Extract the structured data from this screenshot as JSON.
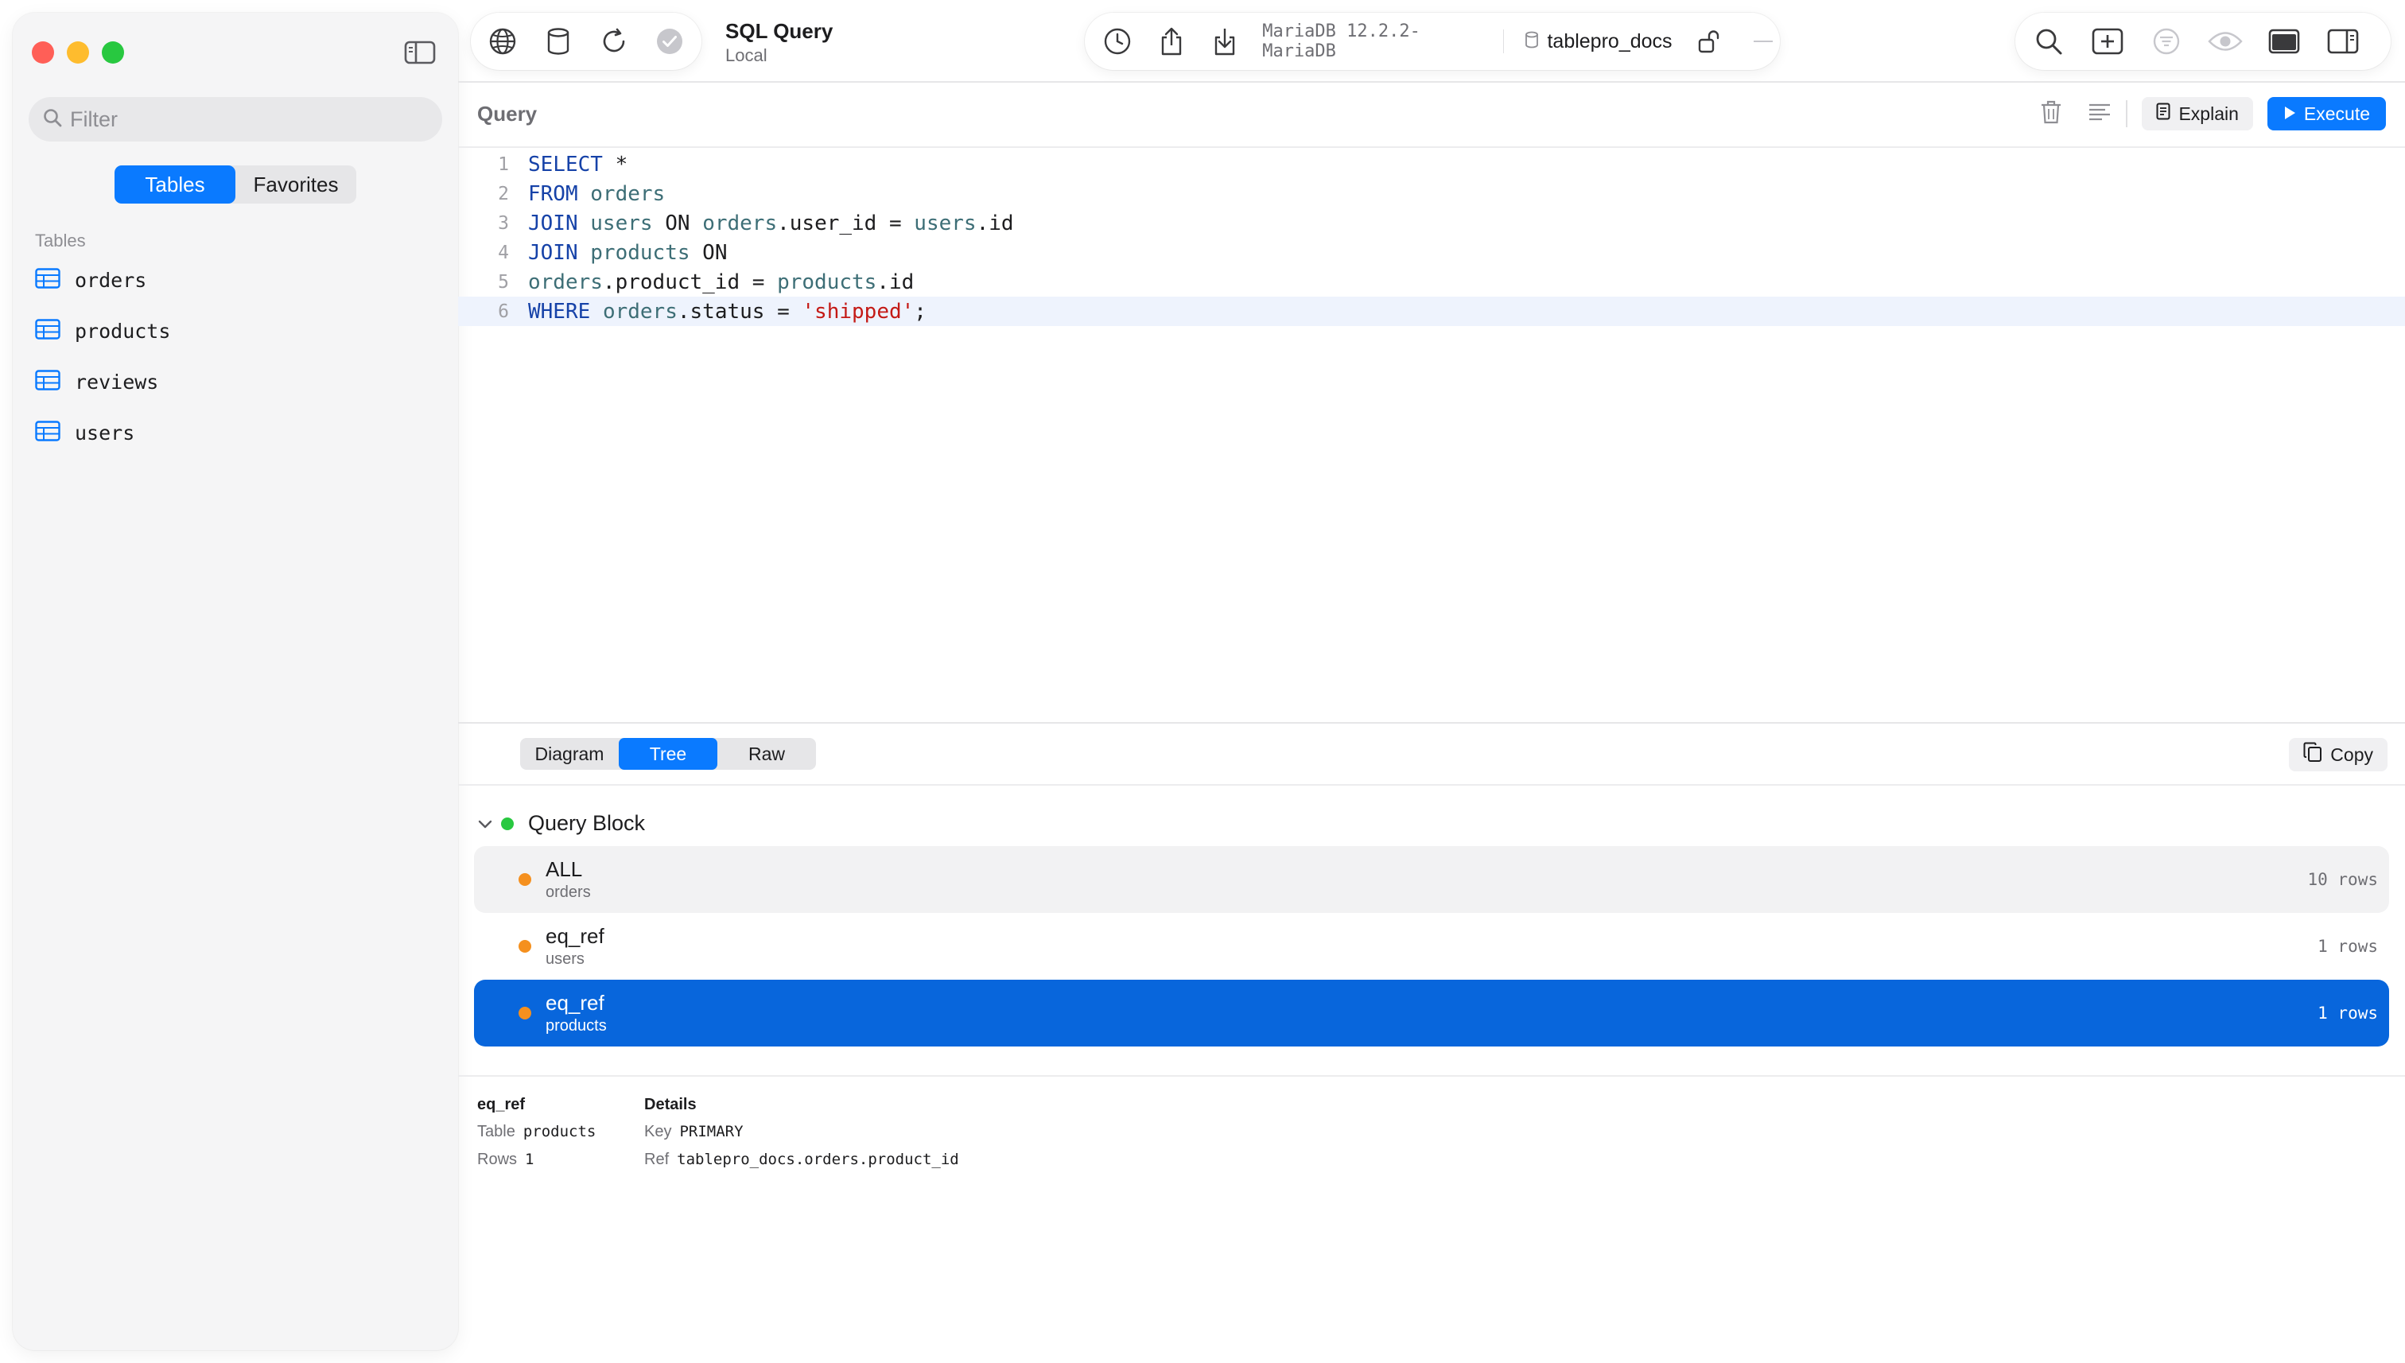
{
  "window": {
    "title": "SQL Query",
    "subtitle": "Local"
  },
  "toolbar": {
    "db_version": "MariaDB 12.2.2-MariaDB",
    "db_name": "tablepro_docs"
  },
  "sidebar": {
    "filter_placeholder": "Filter",
    "tabs": [
      {
        "label": "Tables",
        "active": true
      },
      {
        "label": "Favorites",
        "active": false
      }
    ],
    "section_label": "Tables",
    "tables": [
      "orders",
      "products",
      "reviews",
      "users"
    ]
  },
  "query": {
    "label": "Query",
    "explain_label": "Explain",
    "execute_label": "Execute"
  },
  "editor": {
    "lines": [
      {
        "n": "1",
        "parts": [
          [
            "kw",
            "SELECT"
          ],
          [
            "pl",
            " *"
          ]
        ]
      },
      {
        "n": "2",
        "parts": [
          [
            "kw",
            "FROM"
          ],
          [
            "pl",
            " "
          ],
          [
            "id",
            "orders"
          ]
        ]
      },
      {
        "n": "3",
        "parts": [
          [
            "kw",
            "JOIN"
          ],
          [
            "pl",
            " "
          ],
          [
            "id",
            "users"
          ],
          [
            "pl",
            " ON "
          ],
          [
            "id",
            "orders"
          ],
          [
            "pl",
            ".user_id = "
          ],
          [
            "id",
            "users"
          ],
          [
            "pl",
            ".id"
          ]
        ]
      },
      {
        "n": "4",
        "parts": [
          [
            "kw",
            "JOIN"
          ],
          [
            "pl",
            " "
          ],
          [
            "id",
            "products"
          ],
          [
            "pl",
            " ON"
          ]
        ]
      },
      {
        "n": "5",
        "parts": [
          [
            "id",
            "orders"
          ],
          [
            "pl",
            ".product_id = "
          ],
          [
            "id",
            "products"
          ],
          [
            "pl",
            ".id"
          ]
        ]
      },
      {
        "n": "6",
        "parts": [
          [
            "kw",
            "WHERE"
          ],
          [
            "pl",
            " "
          ],
          [
            "id",
            "orders"
          ],
          [
            "pl",
            ".status = "
          ],
          [
            "str",
            "'shipped'"
          ],
          [
            "pl",
            ";"
          ]
        ]
      }
    ],
    "current_line": 6
  },
  "results": {
    "view_tabs": [
      {
        "label": "Diagram",
        "active": false
      },
      {
        "label": "Tree",
        "active": true
      },
      {
        "label": "Raw",
        "active": false
      }
    ],
    "copy_label": "Copy",
    "query_block_label": "Query Block",
    "plan_rows": [
      {
        "type": "ALL",
        "table": "orders",
        "rows": "10 rows",
        "selected": false
      },
      {
        "type": "eq_ref",
        "table": "users",
        "rows": "1 rows",
        "selected": false
      },
      {
        "type": "eq_ref",
        "table": "products",
        "rows": "1 rows",
        "selected": true
      }
    ],
    "details": {
      "title": "eq_ref",
      "details_heading": "Details",
      "left": [
        {
          "key": "Table",
          "value": "products"
        },
        {
          "key": "Rows",
          "value": "1"
        }
      ],
      "right": [
        {
          "key": "Key",
          "value": "PRIMARY"
        },
        {
          "key": "Ref",
          "value": "tablepro_docs.orders.product_id"
        }
      ]
    }
  },
  "colors": {
    "accent": "#0a7aff",
    "selected_row": "#0866dc",
    "keyword": "#1642a8",
    "identifier": "#3d6e76",
    "string": "#c41a16",
    "status_dot": "#f5901e",
    "query_block_dot": "#28c840"
  },
  "icons": {
    "toolbar_left": [
      "globe-icon",
      "database-icon",
      "refresh-icon",
      "check-icon"
    ],
    "toolbar_mid": [
      "history-icon",
      "share-icon",
      "import-icon",
      "database-small-icon",
      "lock-open-icon",
      "more-icon"
    ],
    "toolbar_right": [
      "search-icon",
      "add-tab-icon",
      "filter-icon",
      "eye-icon",
      "panel-bottom-icon",
      "panel-right-icon"
    ]
  }
}
